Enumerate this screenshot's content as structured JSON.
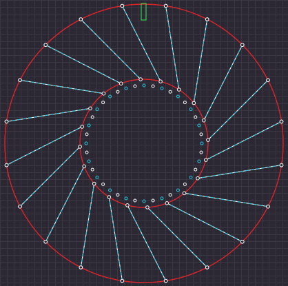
{
  "colors": {
    "background": "#2b2733",
    "grid": "#3a3743",
    "circle": "#d9252c",
    "wire_solid": "#ffffff",
    "wire_dashed": "#29c7dc",
    "handle": "#ffffff",
    "marker": "#2fd04a"
  },
  "drawing": {
    "outer_circle": {
      "style": "solid",
      "color_key": "circle"
    },
    "inner_circle": {
      "style": "solid",
      "color_key": "circle"
    },
    "solid_links": {
      "count": 20,
      "style": "solid",
      "color_key": "wire_solid"
    },
    "dashed_links": {
      "count": 20,
      "style": "dashed",
      "color_key": "wire_dashed"
    },
    "inner_dots": {
      "count": 40
    },
    "selection_marker": {
      "shape": "rectangle",
      "color_key": "marker"
    }
  }
}
